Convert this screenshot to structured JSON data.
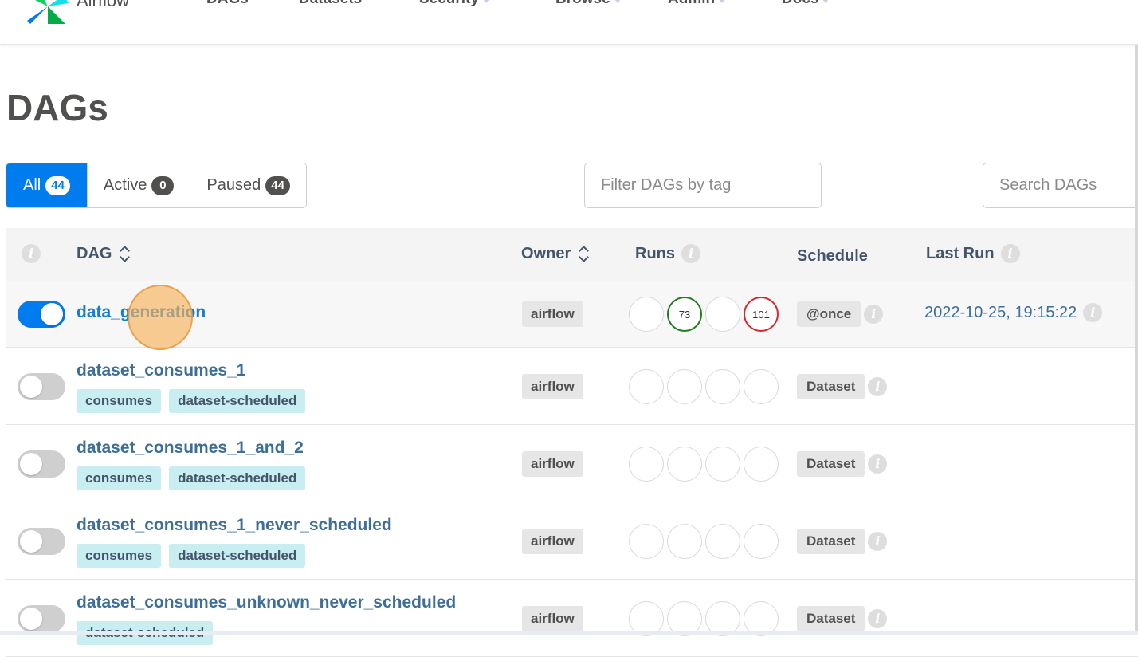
{
  "navbar": {
    "brand": "Airflow",
    "items": [
      {
        "label": "DAGs",
        "dropdown": false
      },
      {
        "label": "Datasets",
        "dropdown": false
      },
      {
        "label": "Security",
        "dropdown": true
      },
      {
        "label": "Browse",
        "dropdown": true
      },
      {
        "label": "Admin",
        "dropdown": true
      },
      {
        "label": "Docs",
        "dropdown": true
      }
    ]
  },
  "page": {
    "title": "DAGs"
  },
  "filters": {
    "all_label": "All",
    "all_count": "44",
    "active_label": "Active",
    "active_count": "0",
    "paused_label": "Paused",
    "paused_count": "44",
    "tag_placeholder": "Filter DAGs by tag",
    "search_placeholder": "Search DAGs"
  },
  "table": {
    "headers": {
      "info": "i",
      "dag": "DAG",
      "owner": "Owner",
      "runs": "Runs",
      "schedule": "Schedule",
      "last_run": "Last Run"
    },
    "rows": [
      {
        "name": "data_generation",
        "toggle_on": true,
        "tags": [],
        "owner": "airflow",
        "runs": [
          {
            "count": "",
            "state": "queued"
          },
          {
            "count": "73",
            "state": "success"
          },
          {
            "count": "",
            "state": "running"
          },
          {
            "count": "101",
            "state": "failed"
          }
        ],
        "schedule": "@once",
        "last_run": "2022-10-25, 19:15:22"
      },
      {
        "name": "dataset_consumes_1",
        "toggle_on": false,
        "tags": [
          "consumes",
          "dataset-scheduled"
        ],
        "owner": "airflow",
        "runs": [
          {
            "count": "",
            "state": "queued"
          },
          {
            "count": "",
            "state": "success"
          },
          {
            "count": "",
            "state": "running"
          },
          {
            "count": "",
            "state": "failed"
          }
        ],
        "schedule": "Dataset",
        "last_run": ""
      },
      {
        "name": "dataset_consumes_1_and_2",
        "toggle_on": false,
        "tags": [
          "consumes",
          "dataset-scheduled"
        ],
        "owner": "airflow",
        "runs": [
          {
            "count": "",
            "state": "queued"
          },
          {
            "count": "",
            "state": "success"
          },
          {
            "count": "",
            "state": "running"
          },
          {
            "count": "",
            "state": "failed"
          }
        ],
        "schedule": "Dataset",
        "last_run": ""
      },
      {
        "name": "dataset_consumes_1_never_scheduled",
        "toggle_on": false,
        "tags": [
          "consumes",
          "dataset-scheduled"
        ],
        "owner": "airflow",
        "runs": [
          {
            "count": "",
            "state": "queued"
          },
          {
            "count": "",
            "state": "success"
          },
          {
            "count": "",
            "state": "running"
          },
          {
            "count": "",
            "state": "failed"
          }
        ],
        "schedule": "Dataset",
        "last_run": ""
      },
      {
        "name": "dataset_consumes_unknown_never_scheduled",
        "toggle_on": false,
        "tags": [
          "dataset-scheduled"
        ],
        "owner": "airflow",
        "runs": [
          {
            "count": "",
            "state": "queued"
          },
          {
            "count": "",
            "state": "success"
          },
          {
            "count": "",
            "state": "running"
          },
          {
            "count": "",
            "state": "failed"
          }
        ],
        "schedule": "Dataset",
        "last_run": ""
      }
    ]
  },
  "colors": {
    "accent": "#017cee",
    "success": "#1e7d1e",
    "failed": "#d9262e",
    "tag_bg": "#c8eef2",
    "cursor": "#f6b25a"
  }
}
